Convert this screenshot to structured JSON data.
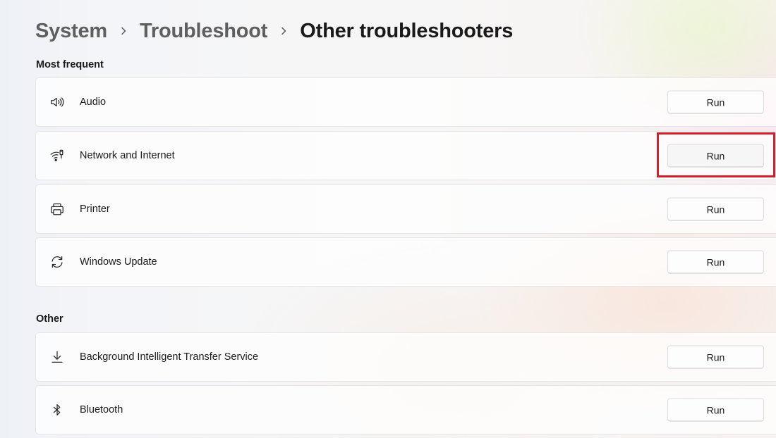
{
  "breadcrumb": {
    "items": [
      "System",
      "Troubleshoot",
      "Other troubleshooters"
    ]
  },
  "sections": {
    "most_frequent": {
      "title": "Most frequent",
      "items": [
        {
          "label": "Audio",
          "icon": "speaker-icon",
          "button": "Run"
        },
        {
          "label": "Network and Internet",
          "icon": "wifi-network-icon",
          "button": "Run"
        },
        {
          "label": "Printer",
          "icon": "printer-icon",
          "button": "Run"
        },
        {
          "label": "Windows Update",
          "icon": "refresh-icon",
          "button": "Run"
        }
      ]
    },
    "other": {
      "title": "Other",
      "items": [
        {
          "label": "Background Intelligent Transfer Service",
          "icon": "download-icon",
          "button": "Run"
        },
        {
          "label": "Bluetooth",
          "icon": "bluetooth-icon",
          "button": "Run"
        }
      ]
    }
  },
  "colors": {
    "highlight": "#d1202b"
  }
}
